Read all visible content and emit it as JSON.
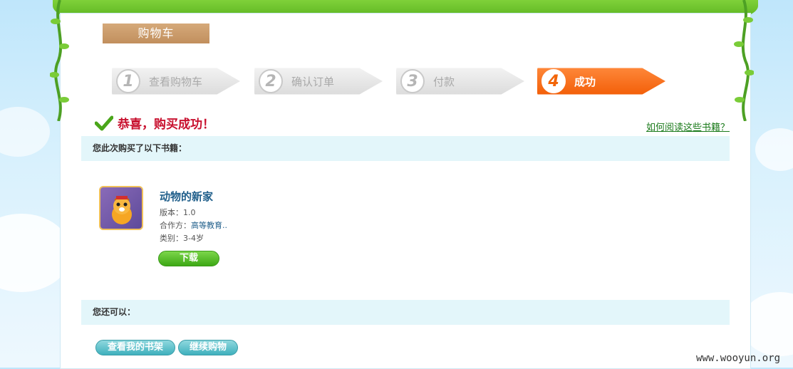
{
  "header": {
    "title": "购物车"
  },
  "steps": [
    {
      "num": "1",
      "label": "查看购物车"
    },
    {
      "num": "2",
      "label": "确认订单"
    },
    {
      "num": "3",
      "label": "付款"
    },
    {
      "num": "4",
      "label": "成功"
    }
  ],
  "success": {
    "message": "恭喜，购买成功！",
    "help_link": "如何阅读这些书籍？"
  },
  "purchased": {
    "heading": "您此次购买了以下书籍：",
    "book": {
      "title": "动物的新家",
      "version_label": "版本：",
      "version_value": "1.0",
      "partner_label": "合作方：",
      "partner_value": "高等教育..",
      "category_label": "类别：",
      "category_value": "3-4岁",
      "download_label": "下载"
    }
  },
  "next": {
    "heading": "您还可以：",
    "bookshelf_label": "查看我的书架",
    "continue_label": "继续购物"
  },
  "watermark": "www.wooyun.org",
  "colors": {
    "accent": "#f25c05",
    "success_text": "#c8102e",
    "bar_bg": "#e3f6fa",
    "download": "#3da815",
    "teal": "#3fb0bd"
  }
}
